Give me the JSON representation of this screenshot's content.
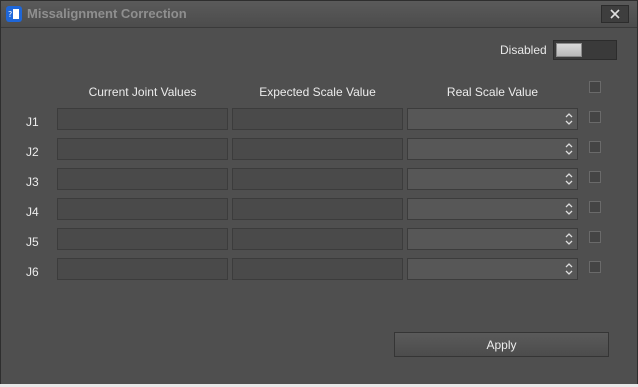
{
  "window": {
    "title": "Missalignment Correction",
    "close_icon": "close-icon"
  },
  "toggle": {
    "label": "Disabled",
    "state": "off"
  },
  "columns": [
    "Current Joint Values",
    "Expected Scale Value",
    "Real Scale Value"
  ],
  "rows": [
    {
      "label": "J1",
      "current": "",
      "expected": "",
      "real": ""
    },
    {
      "label": "J2",
      "current": "",
      "expected": "",
      "real": ""
    },
    {
      "label": "J3",
      "current": "",
      "expected": "",
      "real": ""
    },
    {
      "label": "J4",
      "current": "",
      "expected": "",
      "real": ""
    },
    {
      "label": "J5",
      "current": "",
      "expected": "",
      "real": ""
    },
    {
      "label": "J6",
      "current": "",
      "expected": "",
      "real": ""
    }
  ],
  "apply_label": "Apply"
}
